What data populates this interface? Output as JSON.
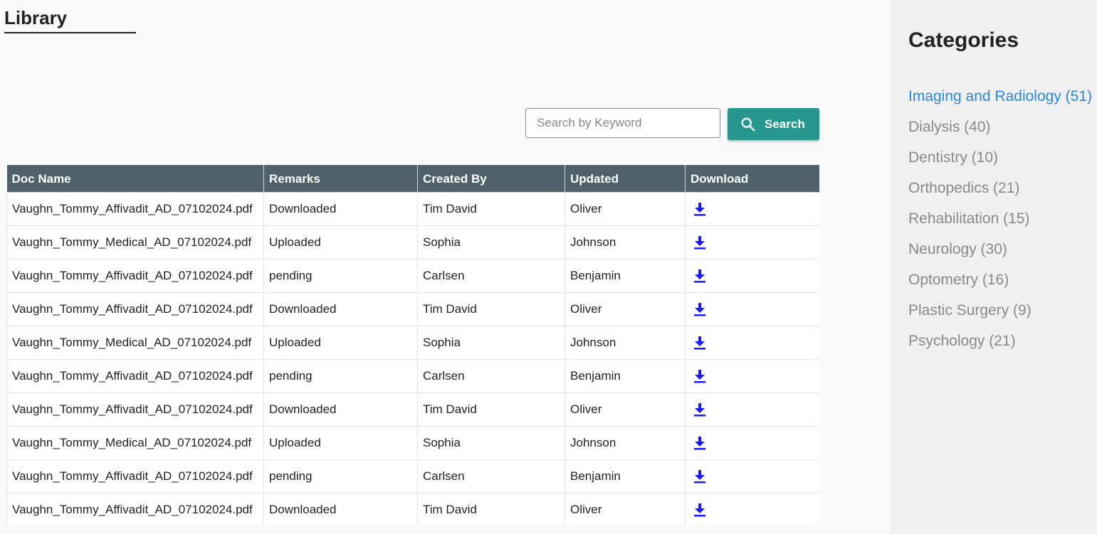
{
  "page": {
    "title": "Library"
  },
  "search": {
    "placeholder": "Search by Keyword",
    "button_label": "Search"
  },
  "table": {
    "columns": [
      "Doc Name",
      "Remarks",
      "Created By",
      "Updated",
      "Download"
    ],
    "rows": [
      [
        "Vaughn_Tommy_Affivadit_AD_07102024.pdf",
        "Downloaded",
        "Tim David",
        "Oliver"
      ],
      [
        "Vaughn_Tommy_Medical_AD_07102024.pdf",
        "Uploaded",
        "Sophia",
        "Johnson"
      ],
      [
        "Vaughn_Tommy_Affivadit_AD_07102024.pdf",
        "pending",
        "Carlsen",
        "Benjamin"
      ],
      [
        "Vaughn_Tommy_Affivadit_AD_07102024.pdf",
        "Downloaded",
        "Tim David",
        "Oliver"
      ],
      [
        "Vaughn_Tommy_Medical_AD_07102024.pdf",
        "Uploaded",
        "Sophia",
        "Johnson"
      ],
      [
        "Vaughn_Tommy_Affivadit_AD_07102024.pdf",
        "pending",
        "Carlsen",
        "Benjamin"
      ],
      [
        "Vaughn_Tommy_Affivadit_AD_07102024.pdf",
        "Downloaded",
        "Tim David",
        "Oliver"
      ],
      [
        "Vaughn_Tommy_Medical_AD_07102024.pdf",
        "Uploaded",
        "Sophia",
        "Johnson"
      ],
      [
        "Vaughn_Tommy_Affivadit_AD_07102024.pdf",
        "pending",
        "Carlsen",
        "Benjamin"
      ],
      [
        "Vaughn_Tommy_Affivadit_AD_07102024.pdf",
        "Downloaded",
        "Tim David",
        "Oliver"
      ]
    ],
    "download_icon": "download-arrow-icon"
  },
  "sidebar": {
    "title": "Categories",
    "items": [
      {
        "label": "Imaging and Radiology (51)",
        "active": true
      },
      {
        "label": "Dialysis (40)",
        "active": false
      },
      {
        "label": "Dentistry (10)",
        "active": false
      },
      {
        "label": "Orthopedics (21)",
        "active": false
      },
      {
        "label": "Rehabilitation (15)",
        "active": false
      },
      {
        "label": "Neurology (30)",
        "active": false
      },
      {
        "label": "Optometry (16)",
        "active": false
      },
      {
        "label": "Plastic Surgery (9)",
        "active": false
      },
      {
        "label": "Psychology (21)",
        "active": false
      }
    ]
  },
  "colors": {
    "accent": "#26968e",
    "table_header": "#4f626b",
    "active_link": "#2b87e0",
    "download_icon": "#1a1aff"
  }
}
